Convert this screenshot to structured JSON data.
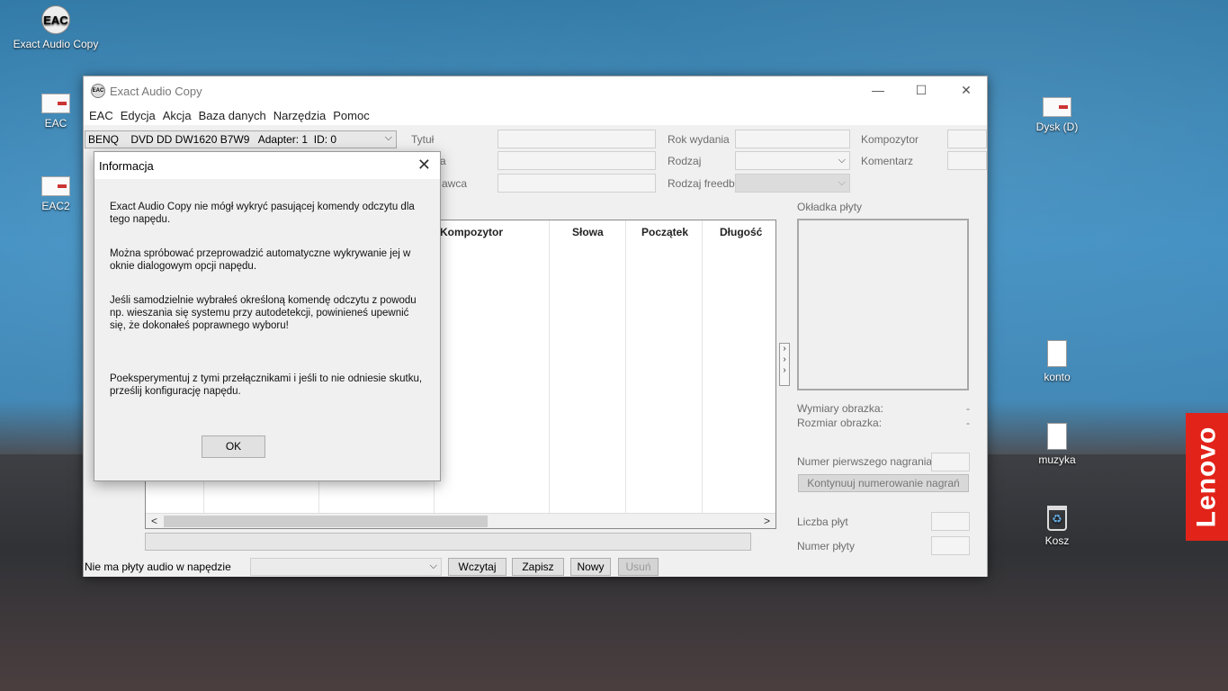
{
  "desktop": {
    "icons": [
      {
        "label": "Exact Audio Copy",
        "glyph": "EAC"
      },
      {
        "label": "EAC"
      },
      {
        "label": "EAC2"
      },
      {
        "label": "Dysk (D)"
      },
      {
        "label": "konto"
      },
      {
        "label": "muzyka"
      },
      {
        "label": "Kosz"
      }
    ],
    "brand": "Lenovo"
  },
  "window": {
    "title": "Exact Audio Copy",
    "icon_text": "EAC",
    "controls": {
      "minimize": "—",
      "maximize": "☐",
      "close": "✕"
    }
  },
  "menu": [
    "EAC",
    "Edycja",
    "Akcja",
    "Baza danych",
    "Narzędzia",
    "Pomoc"
  ],
  "drive_select": "BENQ    DVD DD DW1620 B7W9   Adapter: 1  ID: 0",
  "fields": {
    "tytul": "Tytuł",
    "a_partial": "a",
    "wykonawca_partial": "awca",
    "rok_wydania": "Rok wydania",
    "rodzaj": "Rodzaj",
    "rodzaj_freedb": "Rodzaj freedb",
    "kompozytor": "Kompozytor",
    "komentarz": "Komentarz"
  },
  "table": {
    "headers": [
      "Kompozytor",
      "Słowa",
      "Początek",
      "Długość"
    ]
  },
  "cover": {
    "label": "Okładka płyty",
    "dimensions_label": "Wymiary obrazka:",
    "size_label": "Rozmiar obrazka:",
    "dimensions_value": "-",
    "size_value": "-"
  },
  "numbering": {
    "first_track_label": "Numer pierwszego nagrania:",
    "continue_button": "Kontynuuj numerowanie nagrań",
    "disc_count_label": "Liczba płyt",
    "disc_number_label": "Numer płyty"
  },
  "statusbar": {
    "status": "Nie ma płyty audio w napędzie",
    "buttons": {
      "load": "Wczytaj",
      "save": "Zapisz",
      "new": "Nowy",
      "delete": "Usuń"
    }
  },
  "dialog": {
    "title": "Informacja",
    "paragraphs": [
      "Exact Audio Copy nie mógł wykryć pasującej komendy odczytu dla tego napędu.",
      "Można spróbować przeprowadzić automatyczne wykrywanie jej w oknie dialogowym opcji napędu.",
      "Jeśli samodzielnie wybrałeś określoną komendę odczytu z powodu np. wieszania się systemu przy autodetekcji, powinieneś upewnić się, że dokonałeś poprawnego wyboru!",
      "Poeksperymentuj z tymi przełącznikami i jeśli to nie odniesie skutku, prześlij konfigurację napędu."
    ],
    "ok": "OK",
    "close": "✕"
  },
  "icons": {
    "chevron": "⌵",
    "arrow_left": "<",
    "arrow_right": ">",
    "expand": "›",
    "recycle": "♻"
  }
}
